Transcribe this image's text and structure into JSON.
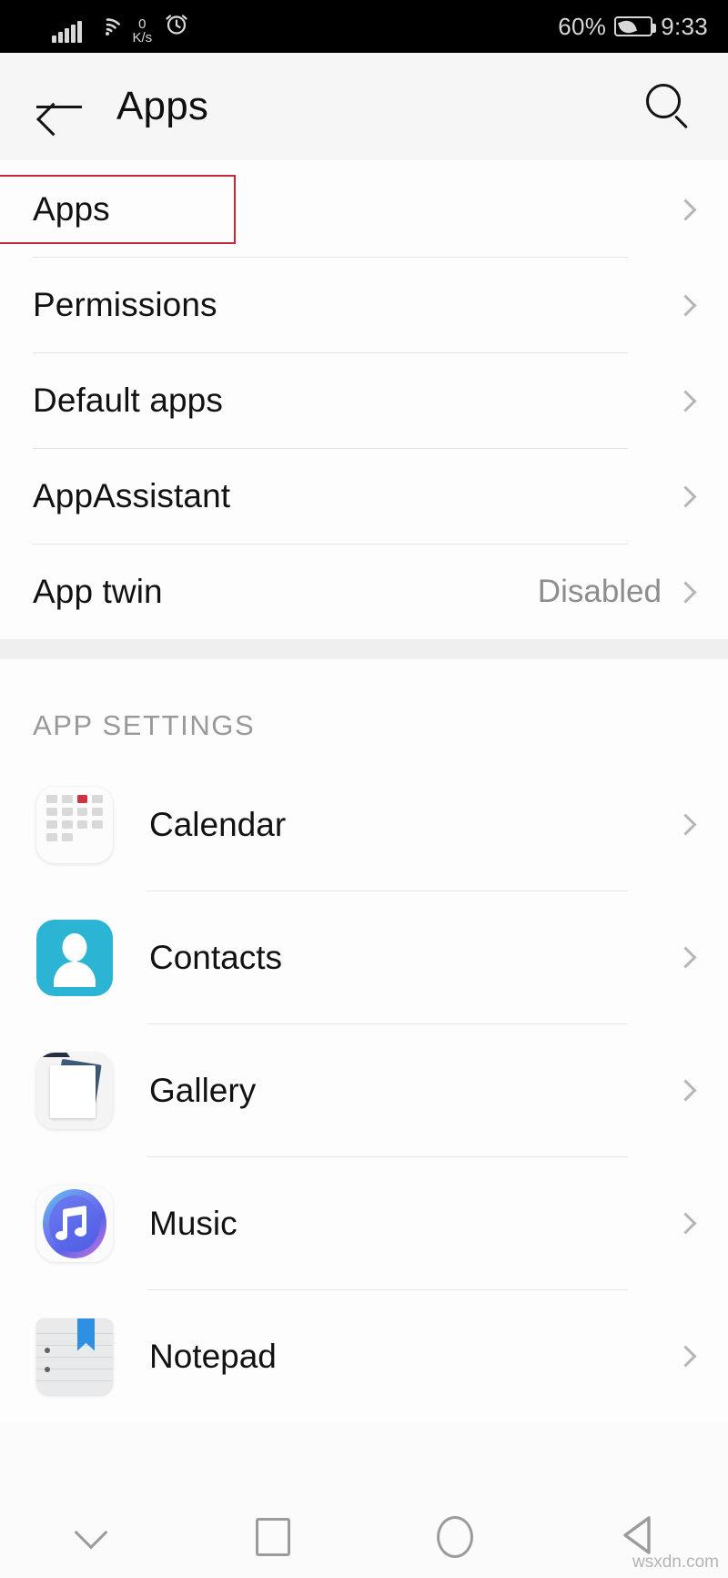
{
  "statusbar": {
    "network_speed_value": "0",
    "network_speed_unit": "K/s",
    "battery_percent": "60%",
    "time": "9:33",
    "icons": [
      "signal-bars-icon",
      "wifi-icon",
      "alarm-clock-icon",
      "battery-saver-icon"
    ]
  },
  "appbar": {
    "title": "Apps",
    "back_icon": "back-arrow-icon",
    "search_icon": "search-icon"
  },
  "settings_rows": [
    {
      "label": "Apps",
      "value": "",
      "highlighted": true
    },
    {
      "label": "Permissions",
      "value": "",
      "highlighted": false
    },
    {
      "label": "Default apps",
      "value": "",
      "highlighted": false
    },
    {
      "label": "AppAssistant",
      "value": "",
      "highlighted": false
    },
    {
      "label": "App twin",
      "value": "Disabled",
      "highlighted": false
    }
  ],
  "app_settings": {
    "section_title": "APP SETTINGS",
    "apps": [
      {
        "name": "Calendar",
        "icon": "calendar-icon"
      },
      {
        "name": "Contacts",
        "icon": "contacts-icon"
      },
      {
        "name": "Gallery",
        "icon": "gallery-icon"
      },
      {
        "name": "Music",
        "icon": "music-icon"
      },
      {
        "name": "Notepad",
        "icon": "notepad-icon"
      }
    ]
  },
  "navbar": {
    "items": [
      "hide-navbar-icon",
      "recents-icon",
      "home-icon",
      "back-icon"
    ]
  },
  "watermark": "wsxdn.com",
  "colors": {
    "highlight_border": "#c42b36",
    "calendar_red": "#cb3440",
    "contacts_teal": "#2cb4d4",
    "notepad_blue": "#2f8fe0",
    "chevron_gray": "#b6b6b6",
    "value_gray": "#8d8d8d",
    "section_label_gray": "#999999"
  }
}
